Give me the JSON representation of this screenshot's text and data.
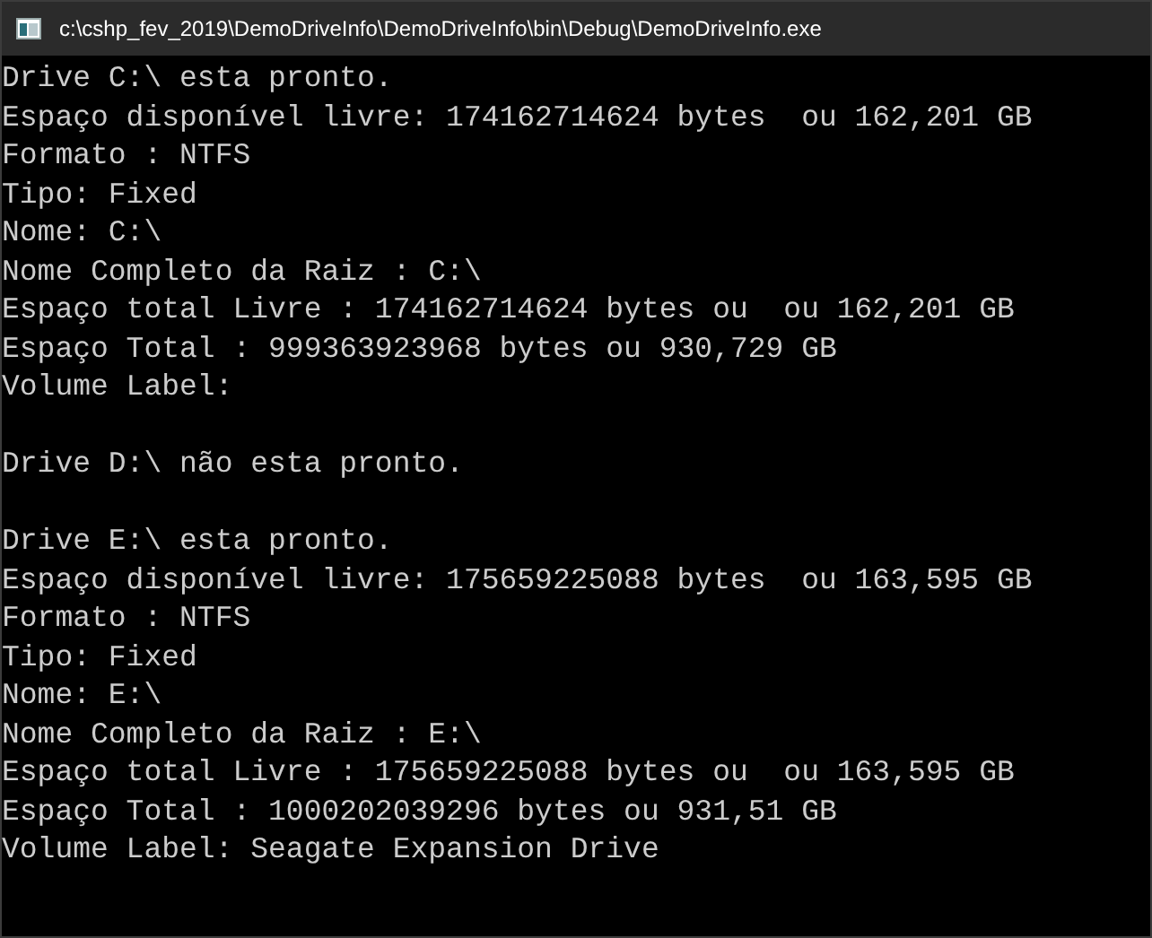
{
  "window": {
    "title": "c:\\cshp_fev_2019\\DemoDriveInfo\\DemoDriveInfo\\bin\\Debug\\DemoDriveInfo.exe"
  },
  "console_lines": [
    {
      "kind": "text",
      "text": "Drive C:\\ esta pronto."
    },
    {
      "kind": "text",
      "text": "Espaço disponível livre: 174162714624 bytes  ou 162,201 GB"
    },
    {
      "kind": "text",
      "text": "Formato : NTFS"
    },
    {
      "kind": "text",
      "text": "Tipo: Fixed"
    },
    {
      "kind": "text",
      "text": "Nome: C:\\"
    },
    {
      "kind": "text",
      "text": "Nome Completo da Raiz : C:\\"
    },
    {
      "kind": "text",
      "text": "Espaço total Livre : 174162714624 bytes ou  ou 162,201 GB"
    },
    {
      "kind": "text",
      "text": "Espaço Total : 999363923968 bytes ou 930,729 GB"
    },
    {
      "kind": "text",
      "text": "Volume Label:"
    },
    {
      "kind": "blank"
    },
    {
      "kind": "text",
      "text": "Drive D:\\ não esta pronto."
    },
    {
      "kind": "blank"
    },
    {
      "kind": "text",
      "text": "Drive E:\\ esta pronto."
    },
    {
      "kind": "text",
      "text": "Espaço disponível livre: 175659225088 bytes  ou 163,595 GB"
    },
    {
      "kind": "text",
      "text": "Formato : NTFS"
    },
    {
      "kind": "text",
      "text": "Tipo: Fixed"
    },
    {
      "kind": "text",
      "text": "Nome: E:\\"
    },
    {
      "kind": "text",
      "text": "Nome Completo da Raiz : E:\\"
    },
    {
      "kind": "text",
      "text": "Espaço total Livre : 175659225088 bytes ou  ou 163,595 GB"
    },
    {
      "kind": "text",
      "text": "Espaço Total : 1000202039296 bytes ou 931,51 GB"
    },
    {
      "kind": "text",
      "text": "Volume Label: Seagate Expansion Drive"
    }
  ]
}
